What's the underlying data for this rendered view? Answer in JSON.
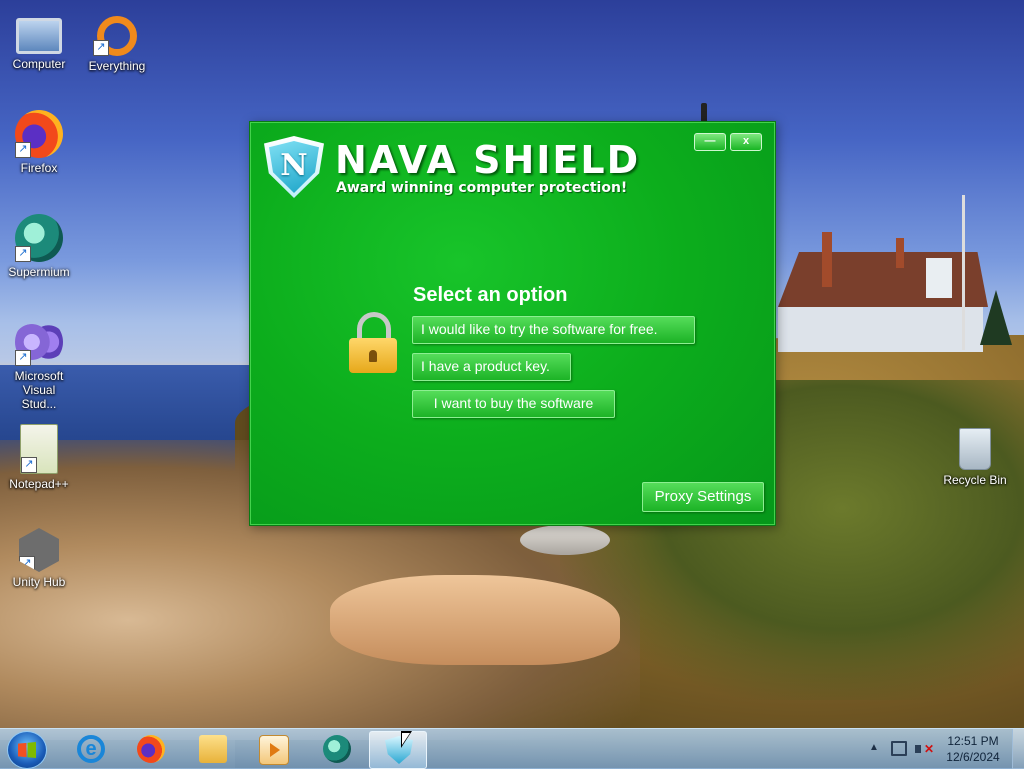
{
  "desktop": {
    "icons": [
      {
        "label": "Computer",
        "icon": "computer-icon"
      },
      {
        "label": "Everything",
        "icon": "everything-icon"
      },
      {
        "label": "Firefox",
        "icon": "firefox-icon"
      },
      {
        "label": "Supermium",
        "icon": "supermium-icon"
      },
      {
        "label": "Microsoft Visual Stud...",
        "icon": "visual-studio-icon"
      },
      {
        "label": "Notepad++",
        "icon": "notepadpp-icon"
      },
      {
        "label": "Unity Hub",
        "icon": "unity-hub-icon"
      },
      {
        "label": "Recycle Bin",
        "icon": "recycle-bin-icon"
      }
    ]
  },
  "app": {
    "title": "NAVA SHIELD",
    "tagline": "Award winning computer protection!",
    "logo_letter": "N",
    "minimize_label": "—",
    "close_label": "x",
    "select_heading": "Select an option",
    "options": [
      {
        "label": "I would like to try the software for free."
      },
      {
        "label": "I have a product key."
      },
      {
        "label": "I want to buy the software"
      }
    ],
    "proxy_label": "Proxy Settings",
    "colors": {
      "accent": "#0cad1c",
      "button": "#1cb326"
    }
  },
  "taskbar": {
    "items": [
      "start-button",
      "internet-explorer-icon",
      "firefox-icon",
      "file-explorer-icon",
      "media-player-icon",
      "supermium-icon",
      "nava-shield-icon"
    ],
    "active_item": "nava-shield-icon",
    "tray": {
      "time": "12:51 PM",
      "date": "12/6/2024",
      "volume": "muted"
    }
  }
}
